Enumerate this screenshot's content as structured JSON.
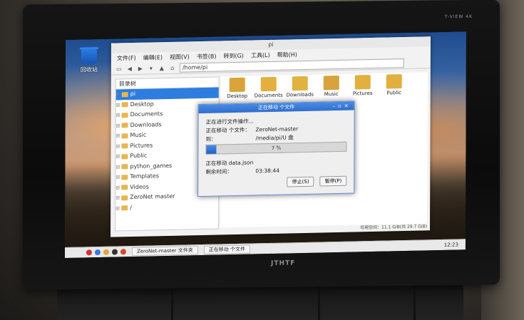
{
  "desktop": {
    "trash_label": "回收站"
  },
  "bezel": {
    "brand": "T-VIEW 4K",
    "logo": "JTHTF"
  },
  "file_manager": {
    "title": "pi",
    "menu": [
      "文件(F)",
      "编辑(E)",
      "视图(V)",
      "书签(B)",
      "转到(G)",
      "工具(L)",
      "帮助(H)"
    ],
    "path": "/home/pi",
    "side_combo": "目录树",
    "tree": [
      {
        "label": "pi",
        "selected": true
      },
      {
        "label": "Desktop"
      },
      {
        "label": "Documents"
      },
      {
        "label": "Downloads"
      },
      {
        "label": "Music"
      },
      {
        "label": "Pictures"
      },
      {
        "label": "Public"
      },
      {
        "label": "python_games"
      },
      {
        "label": "Templates"
      },
      {
        "label": "Videos"
      },
      {
        "label": "ZeroNet master"
      },
      {
        "label": "/"
      }
    ],
    "icons": [
      "Desktop",
      "Documents",
      "Downloads",
      "Music",
      "Pictures",
      "Public"
    ],
    "status_free": "可用空间：11.1 GiB(共",
    "status_total": "29.7 GiB)"
  },
  "dialog": {
    "title": "正在移动 个文件",
    "heading": "正在进行文件操作...",
    "moving_label": "正在移动 个文件：",
    "moving_value": "ZeroNet-master",
    "to_label": "到：",
    "to_value": "/media/pi/U 盘",
    "progress_percent": 7,
    "progress_text": "7 %",
    "current_label": "正在移动 data.json",
    "remaining_label": "剩余时间：",
    "remaining_value": "03:38:44",
    "pause_button": "停止(S)",
    "cancel_button": "暂停(P)"
  },
  "taskbar": {
    "tasks": [
      "ZeroNet-master 文件夹",
      "正在移动 个文件"
    ],
    "clock": "12:23"
  }
}
